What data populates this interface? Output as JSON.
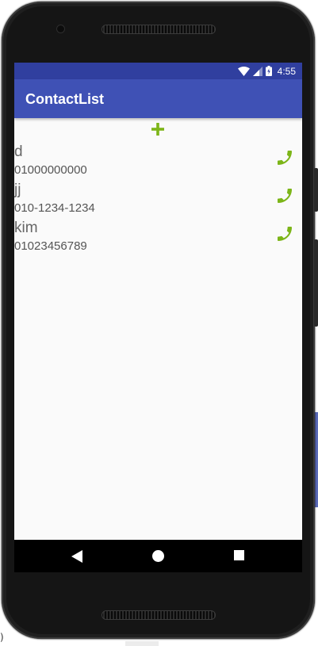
{
  "status_bar": {
    "time": "4:55"
  },
  "app_bar": {
    "title": "ContactList"
  },
  "add_button": {
    "icon": "plus-icon",
    "color": "#7cb518"
  },
  "contacts": [
    {
      "name": "d",
      "phone": "01000000000"
    },
    {
      "name": "jj",
      "phone": "010-1234-1234"
    },
    {
      "name": "kim",
      "phone": "01023456789"
    }
  ],
  "colors": {
    "status_bar": "#303f9f",
    "app_bar": "#3f51b5",
    "accent_green": "#7cb518",
    "nav_bar": "#000000"
  },
  "nav": [
    "back-icon",
    "home-icon",
    "recents-icon"
  ],
  "background_fragment": {
    "text": ")"
  }
}
